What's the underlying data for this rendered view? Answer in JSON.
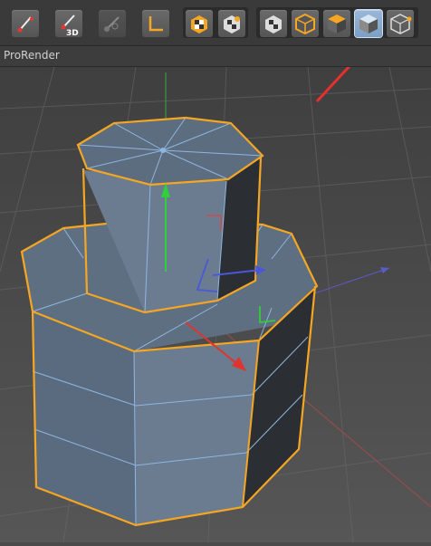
{
  "menu": {
    "label": "ProRender"
  },
  "toolbar": {
    "tools": [
      {
        "icon": "paint-brush-icon",
        "active": false
      },
      {
        "icon": "paint-3d-icon",
        "label": "3D",
        "active": false
      },
      {
        "icon": "brush-disabled-icon",
        "active": false
      },
      {
        "icon": "workplane-icon",
        "active": false
      },
      {
        "icon": "snap-checker-icon",
        "active": false
      },
      {
        "icon": "snap-checker-alt-icon",
        "active": false
      },
      {
        "icon": "model-mode-icon",
        "active": false
      },
      {
        "icon": "object-mode-icon",
        "active": false
      },
      {
        "icon": "animation-mode-icon",
        "active": false
      },
      {
        "icon": "polygon-mode-icon",
        "active": true
      },
      {
        "icon": "point-mode-icon",
        "active": false
      }
    ]
  },
  "colors": {
    "selection": "#f5a623",
    "axis_x": "#e0342c",
    "axis_y": "#2fd13a",
    "axis_z": "#4a58d8",
    "annotation_arrow": "#e5302b",
    "active_button": "#8cacd0"
  }
}
